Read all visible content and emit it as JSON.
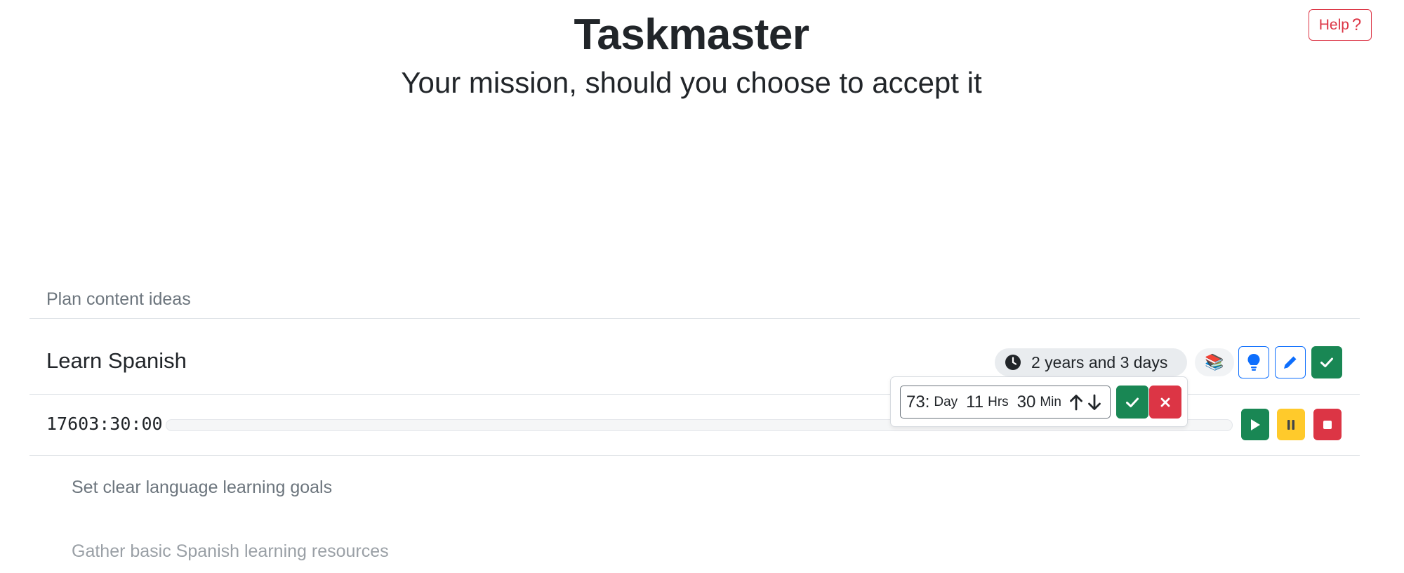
{
  "header": {
    "title": "Taskmaster",
    "subtitle": "Your mission, should you choose to accept it",
    "help_label": "Help",
    "help_icon": "question-mark-icon"
  },
  "tasks": {
    "previous_item": "Plan content ideas",
    "current": {
      "title": "Learn Spanish",
      "duration": "2 years and 3 days",
      "emoji": "📚",
      "timer": "17603:30:00",
      "progress_percent": 0
    },
    "subtasks": [
      "Set clear language learning goals",
      "Gather basic Spanish learning resources"
    ]
  },
  "time_editor": {
    "days_value": "73:",
    "days_unit": "Day",
    "hours_value": "11",
    "hours_unit": "Hrs",
    "minutes_value": "30",
    "minutes_unit": "Min"
  },
  "colors": {
    "primary": "#0d6efd",
    "success": "#198754",
    "warning": "#ffc107",
    "danger": "#dc3545"
  }
}
